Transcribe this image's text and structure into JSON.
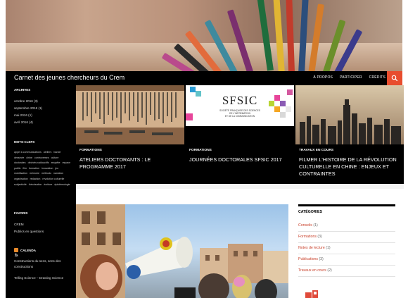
{
  "site": {
    "title": "Carnet des jeunes chercheurs du Crem"
  },
  "nav": {
    "items": [
      "À PROPOS",
      "PARTICIPER",
      "CRÉDITS"
    ],
    "search_icon": "search-icon"
  },
  "sidebar": {
    "archives": {
      "title": "ARCHIVES",
      "items": [
        "octobre 2016 (3)",
        "septembre 2016 (1)",
        "mai 2016 (1)",
        "avril 2016 (4)"
      ]
    },
    "tags": {
      "title": "MOTS-CLEFS",
      "items": [
        "appel à communications",
        "ateliers",
        "bande dessinée",
        "chine",
        "controverses",
        "culture",
        "doctorales",
        "déchets radioactifs",
        "enquête",
        "espace public",
        "film",
        "formation",
        "innovation",
        "jeu",
        "mobilisation",
        "mémoire",
        "méthodo",
        "narration",
        "organisation",
        "rédaction",
        "révolution culturelle",
        "subjectivité",
        "théorisation",
        "écriture",
        "épistémologie"
      ]
    },
    "favoris": {
      "title": "FAVORIS",
      "items": [
        "CREM",
        "Publics en questions"
      ]
    },
    "calenda": {
      "title": "CALENDA",
      "icon": "rss-icon",
      "items": [
        "Constructions du sens, sens des constructions",
        "Telling Science – Drawing Science"
      ]
    }
  },
  "featured": [
    {
      "category": "FORMATIONS",
      "title": "Ateliers doctorants : le programme 2017"
    },
    {
      "category": "FORMATIONS",
      "title": "Journées doctorales SFSIC 2017",
      "thumb_text": {
        "logo": "SFSIC",
        "lines": [
          "SOCIÉTÉ FRANÇAISE DES SCIENCES",
          "DE L'INFORMATION",
          "ET DE LA COMMUNICATION"
        ]
      }
    },
    {
      "category": "TRAVAUX EN COURS",
      "title": "Filmer l'histoire de la révolution culturelle en Chine : enjeux et contraintes"
    }
  ],
  "categories": {
    "title": "CATÉGORIES",
    "items": [
      {
        "name": "Conseils",
        "count": "(1)"
      },
      {
        "name": "Formations",
        "count": "(3)"
      },
      {
        "name": "Notes de lecture",
        "count": "(1)"
      },
      {
        "name": "Publications",
        "count": "(3)"
      },
      {
        "name": "Travaux en cours",
        "count": "(2)"
      }
    ]
  },
  "colors": {
    "accent": "#e84d2e",
    "link": "#c9402a",
    "dark": "#000000"
  }
}
